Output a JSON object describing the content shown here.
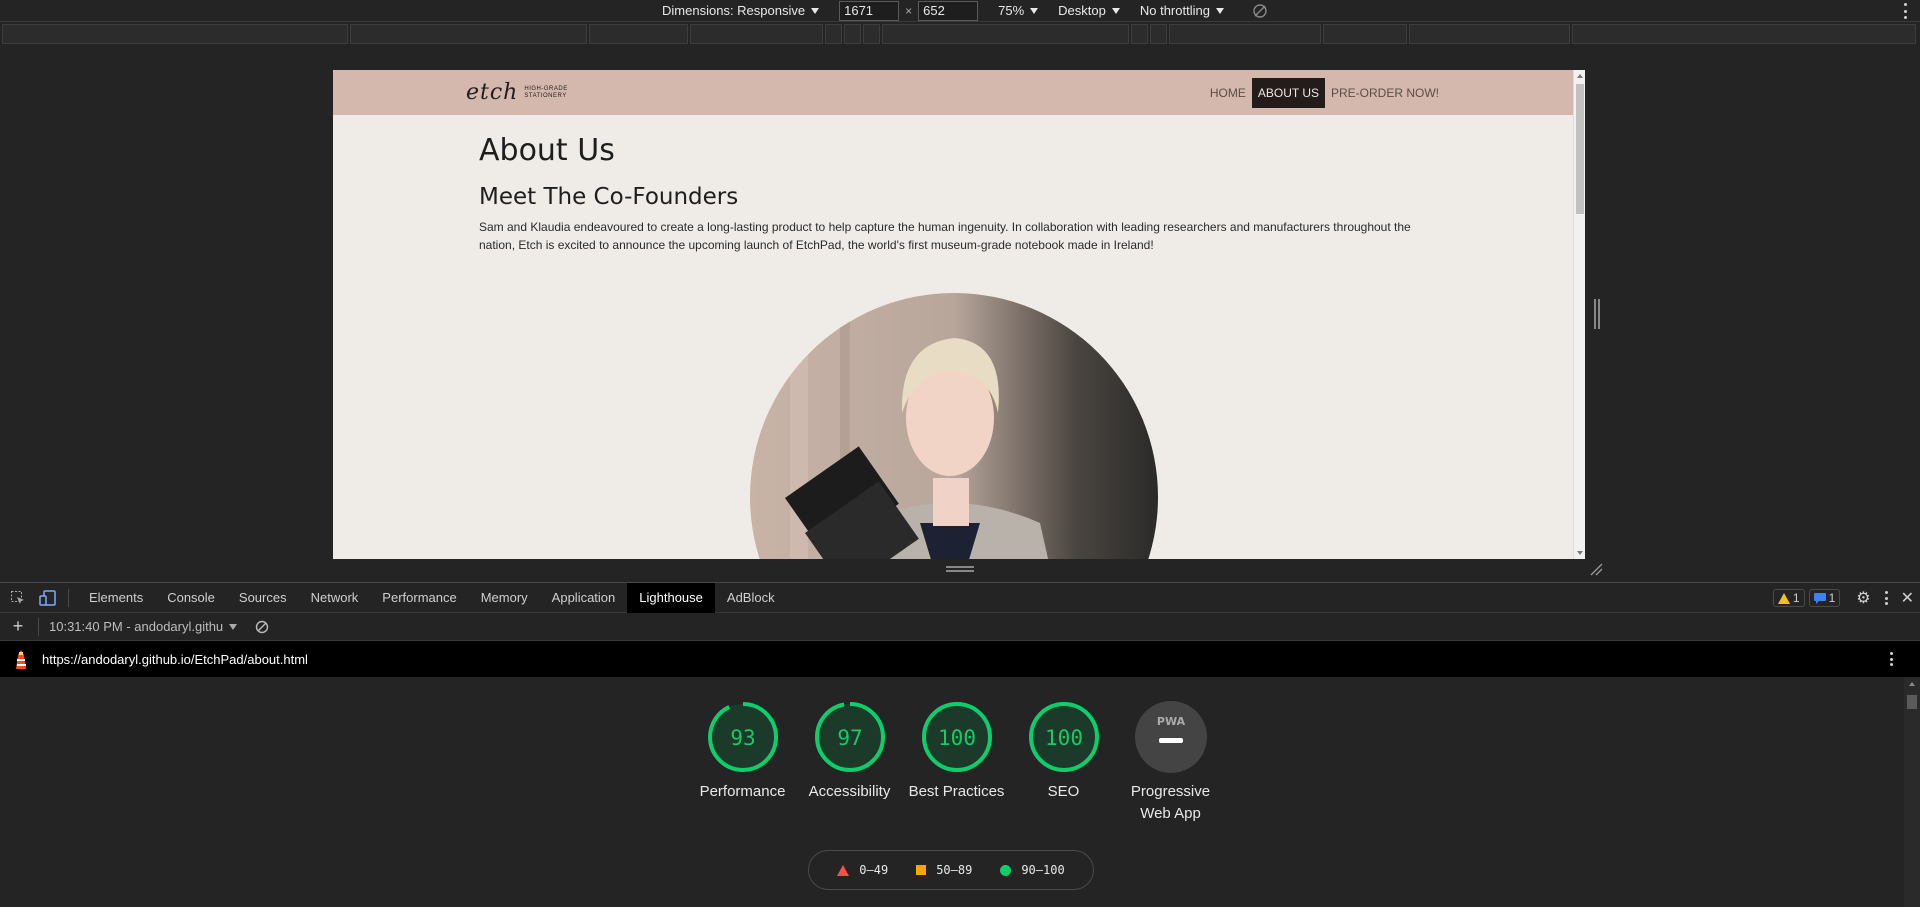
{
  "device_toolbar": {
    "dimensions_label": "Dimensions: Responsive",
    "width": "1671",
    "times": "×",
    "height": "652",
    "zoom": "75%",
    "device_type": "Desktop",
    "throttling": "No throttling"
  },
  "site": {
    "logo_script": "etch",
    "logo_tag_line1": "HIGH-GRADE",
    "logo_tag_line2": "STATIONERY",
    "nav": [
      {
        "label": "HOME",
        "active": false
      },
      {
        "label": "ABOUT US",
        "active": true
      },
      {
        "label": "PRE-ORDER NOW!",
        "active": false
      }
    ],
    "page_title": "About Us",
    "section_title": "Meet The Co-Founders",
    "intro": "Sam and Klaudia endeavoured to create a long-lasting product to help capture the human ingenuity. In collaboration with leading researchers and manufacturers throughout the nation, Etch is excited to announce the upcoming launch of EtchPad, the world's first museum-grade notebook made in Ireland!"
  },
  "devtools": {
    "tabs": [
      "Elements",
      "Console",
      "Sources",
      "Network",
      "Performance",
      "Memory",
      "Application",
      "Lighthouse",
      "AdBlock"
    ],
    "active_tab": "Lighthouse",
    "warnings_count": "1",
    "messages_count": "1",
    "report_selector": "10:31:40 PM - andodaryl.githu",
    "report_url": "https://andodaryl.github.io/EtchPad/about.html",
    "gauges": [
      {
        "score": "93",
        "label": "Performance",
        "value": 93
      },
      {
        "score": "97",
        "label": "Accessibility",
        "value": 97
      },
      {
        "score": "100",
        "label": "Best Practices",
        "value": 100
      },
      {
        "score": "100",
        "label": "SEO",
        "value": 100
      }
    ],
    "pwa": {
      "badge": "PWA",
      "label": "Progressive Web App"
    },
    "legend": [
      {
        "range": "0–49",
        "color": "#ff4e42"
      },
      {
        "range": "50–89",
        "color": "#ffa400"
      },
      {
        "range": "90–100",
        "color": "#0cce6b"
      }
    ],
    "score_color": "#0cce6b"
  }
}
